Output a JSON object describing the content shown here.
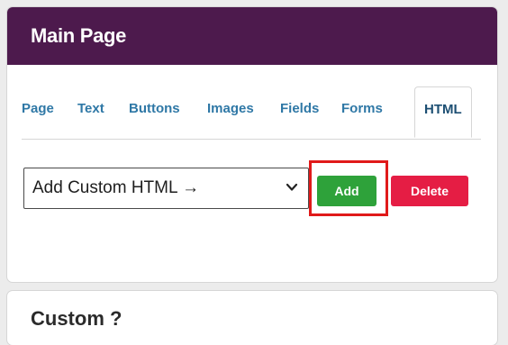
{
  "panel": {
    "title": "Main Page"
  },
  "tabs": [
    {
      "label": "Page",
      "active": false
    },
    {
      "label": "Text",
      "active": false
    },
    {
      "label": "Buttons",
      "active": false
    },
    {
      "label": "Images",
      "active": false
    },
    {
      "label": "Fields",
      "active": false
    },
    {
      "label": "Forms",
      "active": false
    },
    {
      "label": "HTML",
      "active": true
    }
  ],
  "select": {
    "value": "Add Custom HTML →",
    "icon": "chevron-down-icon"
  },
  "buttons": {
    "add_label": "Add",
    "delete_label": "Delete"
  },
  "panel2": {
    "title": "Custom ?"
  },
  "colors": {
    "header_bg": "#4d1a4d",
    "tab_text": "#2f78a6",
    "add_button": "#2ea23a",
    "delete_button": "#e51d44",
    "highlight_border": "#e01a1a"
  }
}
